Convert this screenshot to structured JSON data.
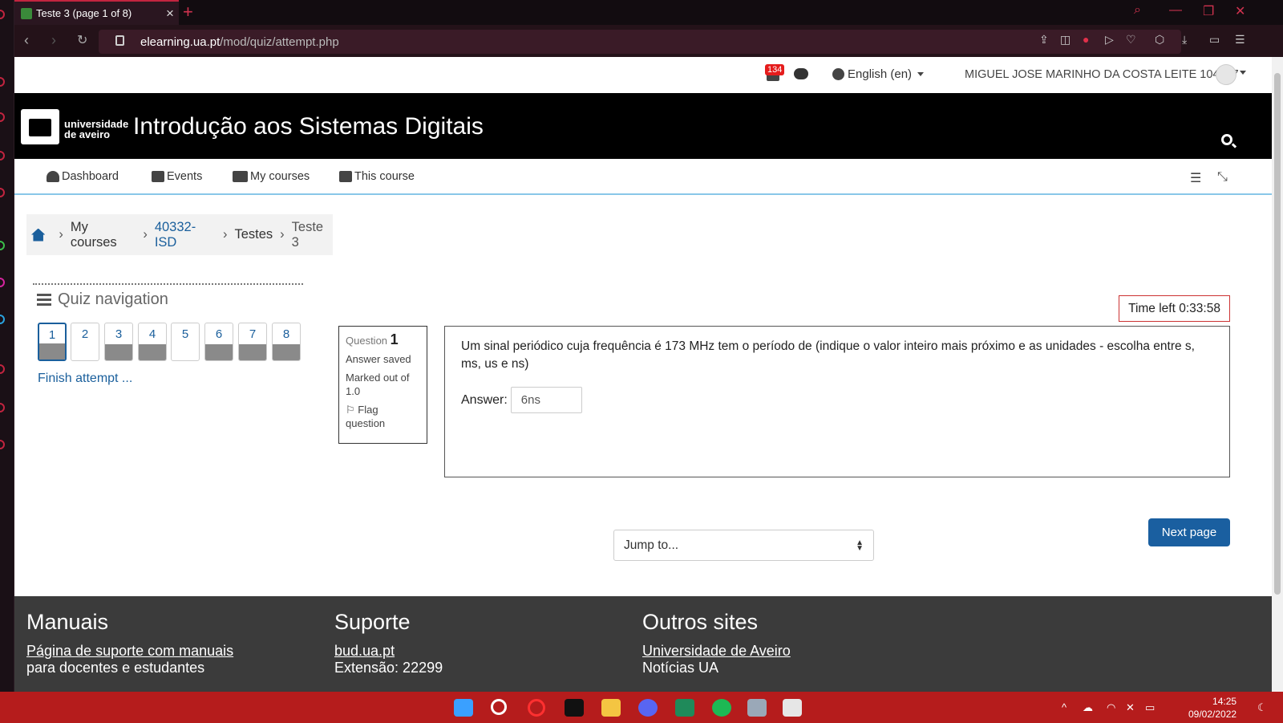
{
  "browser": {
    "tab_title": "Teste 3 (page 1 of 8)",
    "url_host": "elearning.ua.pt",
    "url_path": "/mod/quiz/attempt.php"
  },
  "usernav": {
    "notification_count": "134",
    "language": "English (en)",
    "username": "MIGUEL JOSE MARINHO DA COSTA LEITE 104437"
  },
  "header": {
    "logo_line1": "universidade",
    "logo_line2": "de aveiro",
    "course_title": "Introdução aos Sistemas Digitais"
  },
  "primary_nav": {
    "items": [
      {
        "label": "Dashboard",
        "icon": "dashboard-icon"
      },
      {
        "label": "Events",
        "icon": "calendar-icon"
      },
      {
        "label": "My courses",
        "icon": "briefcase-icon"
      },
      {
        "label": "This course",
        "icon": "sitemap-icon"
      }
    ]
  },
  "breadcrumb": {
    "items": [
      "My courses",
      "40332-ISD",
      "Testes",
      "Teste 3"
    ]
  },
  "quiz_nav": {
    "title": "Quiz navigation",
    "questions": [
      "1",
      "2",
      "3",
      "4",
      "5",
      "6",
      "7",
      "8"
    ],
    "finish_label": "Finish attempt ..."
  },
  "question_info": {
    "label": "Question",
    "number": "1",
    "state": "Answer saved",
    "marks": "Marked out of 1.0",
    "flag": "Flag question"
  },
  "timer": {
    "text": "Time left 0:33:58"
  },
  "question": {
    "text": "Um sinal periódico cuja frequência é 173 MHz tem o período de (indique o valor inteiro mais próximo e as unidades - escolha entre s, ms, us e ns)",
    "answer_label": "Answer:",
    "answer_value": "6ns"
  },
  "actions": {
    "jump_placeholder": "Jump to...",
    "next_label": "Next page"
  },
  "footer": {
    "col1_title": "Manuais",
    "col1_link": "Página de suporte com manuais",
    "col1_text": "para docentes e estudantes",
    "col2_title": "Suporte",
    "col2_link": "bud.ua.pt",
    "col2_text": "Extensão: 22299",
    "col3_title": "Outros sites",
    "col3_link": "Universidade de Aveiro",
    "col3_text": "Notícias UA"
  },
  "taskbar": {
    "time": "14:25",
    "date": "09/02/2022"
  }
}
